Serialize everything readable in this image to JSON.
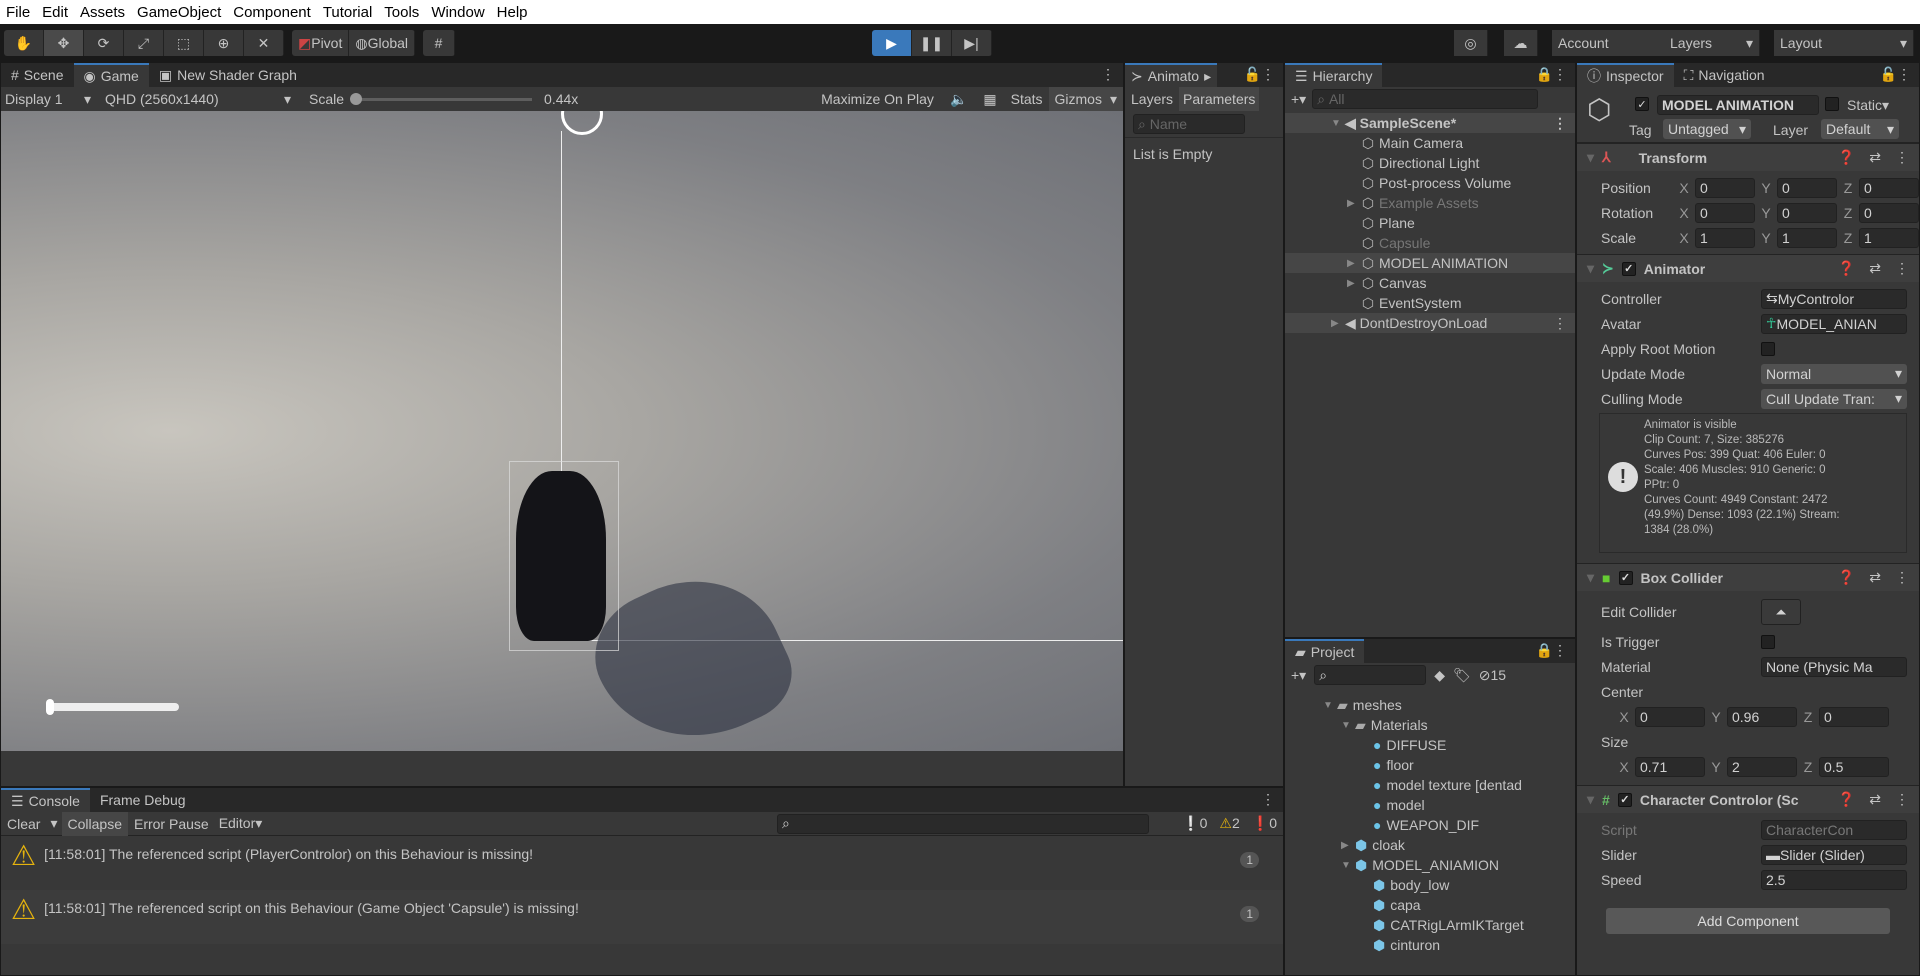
{
  "menu": [
    "File",
    "Edit",
    "Assets",
    "GameObject",
    "Component",
    "Tutorial",
    "Tools",
    "Window",
    "Help"
  ],
  "toolbar": {
    "tools": [
      "hand-icon",
      "move-icon",
      "rotate-icon",
      "scale-icon",
      "rect-icon",
      "transform-icon",
      "custom-tool-icon"
    ],
    "pivot": "Pivot",
    "global": "Global",
    "account": "Account",
    "layers": "Layers",
    "layout": "Layout",
    "accent": "#3a79bb"
  },
  "game": {
    "tabs": [
      "Scene",
      "Game",
      "New Shader Graph"
    ],
    "display": "Display 1",
    "resolution": "QHD (2560x1440)",
    "scale_label": "Scale",
    "scale_value": "0.44x",
    "maximize": "Maximize On Play",
    "stats": "Stats",
    "gizmos": "Gizmos",
    "ui_slider_value": 0
  },
  "animator": {
    "tab": "Animato",
    "layers": "Layers",
    "parameters": "Parameters",
    "search_placeholder": "Name",
    "empty": "List is Empty"
  },
  "hierarchy": {
    "tab": "Hierarchy",
    "search_placeholder": "All",
    "scene": "SampleScene*",
    "items": [
      {
        "label": "Main Camera",
        "dim": false,
        "arrow": false
      },
      {
        "label": "Directional Light",
        "dim": false,
        "arrow": false
      },
      {
        "label": "Post-process Volume",
        "dim": false,
        "arrow": false
      },
      {
        "label": "Example Assets",
        "dim": true,
        "arrow": true
      },
      {
        "label": "Plane",
        "dim": false,
        "arrow": false
      },
      {
        "label": "Capsule",
        "dim": true,
        "arrow": false
      },
      {
        "label": "MODEL ANIMATION",
        "dim": false,
        "arrow": true,
        "selected": true
      },
      {
        "label": "Canvas",
        "dim": false,
        "arrow": true
      },
      {
        "label": "EventSystem",
        "dim": false,
        "arrow": false
      }
    ],
    "ddol": "DontDestroyOnLoad"
  },
  "project": {
    "tab": "Project",
    "hidden_count": "15",
    "items": [
      {
        "label": "meshes",
        "depth": 0,
        "icon": "folder",
        "arrow": "open"
      },
      {
        "label": "Materials",
        "depth": 1,
        "icon": "folder",
        "arrow": "open"
      },
      {
        "label": "DIFFUSE",
        "depth": 2,
        "icon": "material"
      },
      {
        "label": "floor",
        "depth": 2,
        "icon": "material"
      },
      {
        "label": "model texture [dentad",
        "depth": 2,
        "icon": "material"
      },
      {
        "label": "model",
        "depth": 2,
        "icon": "material"
      },
      {
        "label": "WEAPON_DIF",
        "depth": 2,
        "icon": "material"
      },
      {
        "label": "cloak",
        "depth": 1,
        "icon": "prefab",
        "arrow": "closed"
      },
      {
        "label": "MODEL_ANIAMION",
        "depth": 1,
        "icon": "prefab",
        "arrow": "open"
      },
      {
        "label": "body_low",
        "depth": 2,
        "icon": "mesh"
      },
      {
        "label": "capa",
        "depth": 2,
        "icon": "mesh"
      },
      {
        "label": "CATRigLArmIKTarget",
        "depth": 2,
        "icon": "mesh"
      },
      {
        "label": "cinturon",
        "depth": 2,
        "icon": "mesh"
      }
    ]
  },
  "inspector": {
    "tab": "Inspector",
    "nav_tab": "Navigation",
    "object_name": "MODEL ANIMATION",
    "static": "Static",
    "tag_label": "Tag",
    "tag": "Untagged",
    "layer_label": "Layer",
    "layer": "Default",
    "transform": {
      "title": "Transform",
      "rows": [
        {
          "label": "Position",
          "x": "0",
          "y": "0",
          "z": "0"
        },
        {
          "label": "Rotation",
          "x": "0",
          "y": "0",
          "z": "0"
        },
        {
          "label": "Scale",
          "x": "1",
          "y": "1",
          "z": "1"
        }
      ]
    },
    "animator": {
      "title": "Animator",
      "controller_label": "Controller",
      "controller": "MyControlor",
      "avatar_label": "Avatar",
      "avatar": "MODEL_ANIAN",
      "root_motion": "Apply Root Motion",
      "update_label": "Update Mode",
      "update": "Normal",
      "culling_label": "Culling Mode",
      "culling": "Cull Update Tran:",
      "info": [
        "Animator is visible",
        "Clip Count: 7, Size: 385276",
        "Curves Pos: 399 Quat: 406 Euler: 0",
        "Scale: 406 Muscles: 910 Generic: 0",
        "PPtr: 0",
        "Curves Count: 4949 Constant: 2472",
        "(49.9%) Dense: 1093 (22.1%) Stream:",
        "1384 (28.0%)"
      ]
    },
    "box": {
      "title": "Box Collider",
      "edit": "Edit Collider",
      "trigger": "Is Trigger",
      "material_label": "Material",
      "material": "None (Physic Ma",
      "center": "Center",
      "cx": "0",
      "cy": "0.96",
      "cz": "0",
      "size": "Size",
      "sx": "0.71",
      "sy": "2",
      "sz": "0.5"
    },
    "cc": {
      "title": "Character Controlor (Sc",
      "script_label": "Script",
      "script": "CharacterCon",
      "slider_label": "Slider",
      "slider": "Slider (Slider)",
      "speed_label": "Speed",
      "speed": "2.5"
    },
    "add": "Add Component"
  },
  "console": {
    "tabs": [
      "Console",
      "Frame Debug"
    ],
    "clear": "Clear",
    "collapse": "Collapse",
    "error_pause": "Error Pause",
    "editor": "Editor",
    "count_info": "0",
    "count_warn": "2",
    "count_error": "0",
    "logs": [
      {
        "text": "[11:58:01] The referenced script (PlayerControlor) on this Behaviour is missing!",
        "count": "1"
      },
      {
        "text": "[11:58:01] The referenced script on this Behaviour (Game Object 'Capsule') is missing!",
        "count": "1"
      }
    ]
  }
}
